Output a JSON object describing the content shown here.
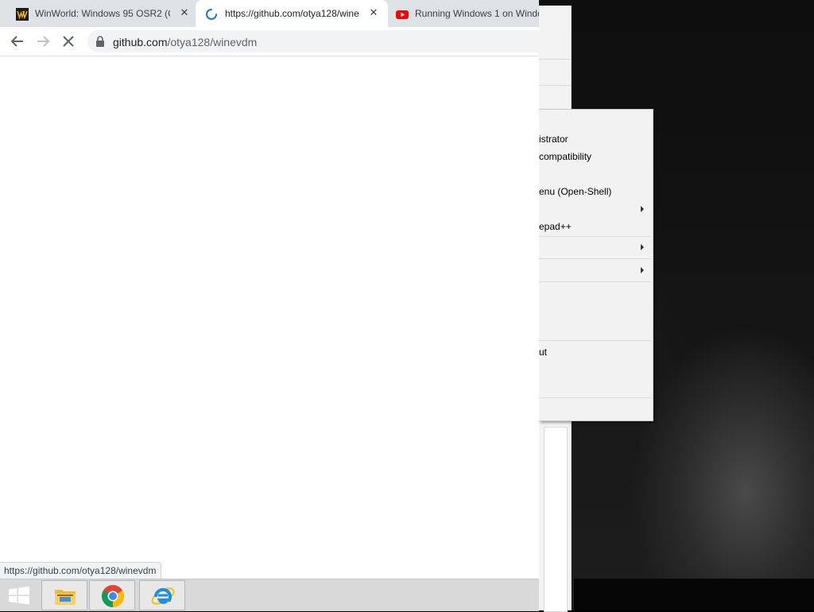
{
  "browser": {
    "tabs": [
      {
        "title": "WinWorld: Windows 95 OSR2 (C",
        "favicon": "winworld-logo-icon",
        "active": false
      },
      {
        "title": "https://github.com/otya128/wine",
        "favicon": "loading-spinner-icon",
        "active": true
      },
      {
        "title": "Running Windows 1 on Windo",
        "favicon": "youtube-icon",
        "active": false
      }
    ],
    "toolbar": {
      "back": "back-arrow-icon",
      "forward": "forward-arrow-icon",
      "stop": "stop-x-icon"
    },
    "omnibox": {
      "host": "github.com",
      "path": "/otya128/winevdm",
      "lock": "lock-icon"
    },
    "status_url": "https://github.com/otya128/winevdm"
  },
  "context_menu": {
    "items": [
      {
        "label": "istrator",
        "submenu": false
      },
      {
        "label": " compatibility",
        "submenu": false
      },
      {
        "label": "enu (Open-Shell)",
        "submenu": false
      },
      {
        "label": "",
        "submenu": true
      },
      {
        "label": "epad++",
        "submenu": false
      },
      {
        "label": "",
        "submenu": true
      },
      {
        "label": "",
        "submenu": true
      },
      {
        "label": "ut",
        "submenu": false
      }
    ]
  },
  "taskbar": {
    "start": "windows-logo-icon",
    "apps": [
      {
        "name": "file-explorer-icon"
      },
      {
        "name": "chrome-icon"
      },
      {
        "name": "internet-explorer-icon"
      }
    ]
  },
  "colors": {
    "tabstrip": "#dee1e6",
    "omnibox": "#f1f3f4",
    "taskbar": "#d9d9d9",
    "menu": "#f2f2f2",
    "youtube_red": "#ff0000",
    "spinner_blue": "#1a73e8"
  }
}
